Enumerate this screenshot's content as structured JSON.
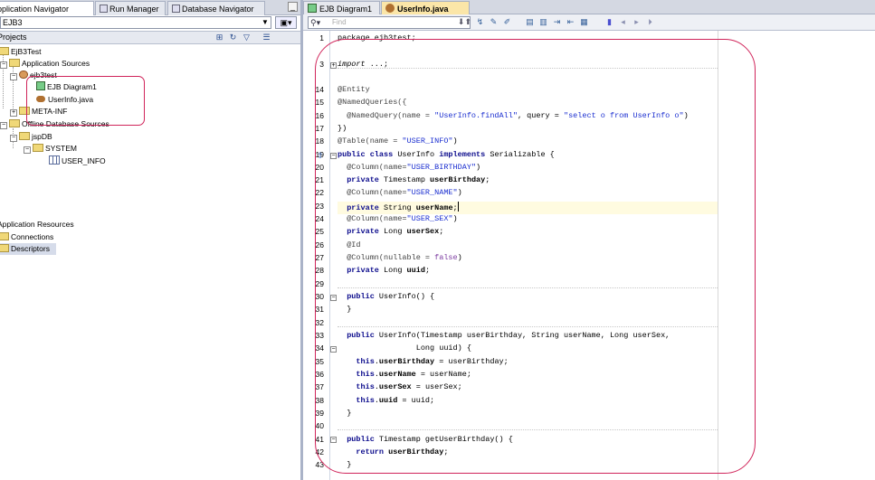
{
  "left_tabs": [
    "Application Navigator",
    "Run Manager",
    "Database Navigator"
  ],
  "app_combo_value": "EJB3",
  "projects_label": "Projects",
  "tree": {
    "project": "EjB3Test",
    "app_sources": "Application Sources",
    "package": "ejb3test",
    "diagram": "EJB Diagram1",
    "userinfo": "UserInfo.java",
    "metainf": "META-INF",
    "offline": "Offline Database Sources",
    "jspdb": "jspDB",
    "system": "SYSTEM",
    "user_info": "USER_INFO"
  },
  "resources": {
    "header": "Application Resources",
    "connections": "Connections",
    "descriptors": "Descriptors"
  },
  "editor_tabs": [
    "EJB Diagram1",
    "UserInfo.java"
  ],
  "find_placeholder": "Find",
  "line_numbers": [
    "1",
    "",
    "3",
    "",
    "",
    "14",
    "15",
    "16",
    "17",
    "18",
    "19",
    "20",
    "21",
    "22",
    "23",
    "24",
    "25",
    "26",
    "27",
    "28",
    "29",
    "30",
    "31",
    "32",
    "33",
    "34",
    "35",
    "36",
    "37",
    "38",
    "39",
    "40",
    "41",
    "42",
    "43"
  ],
  "code": {
    "l1": "package ejb3test;",
    "l3_kw": "import",
    "l3_rest": " ...;",
    "l14": "@Entity",
    "l15": "@NamedQueries({",
    "l16_a": "  @NamedQuery(name = ",
    "l16_s1": "\"UserInfo.findAll\"",
    "l16_b": ", query = ",
    "l16_s2": "\"select o from UserInfo o\"",
    "l16_c": ")",
    "l17": "})",
    "l18_a": "@Table(name = ",
    "l18_s": "\"USER_INFO\"",
    "l18_b": ")",
    "l19_k1": "public class",
    "l19_a": " UserInfo ",
    "l19_k2": "implements",
    "l19_b": " Serializable {",
    "l20_a": "  @Column(name=",
    "l20_s": "\"USER_BIRTHDAY\"",
    "l20_b": ")",
    "l21_k": "  private",
    "l21_a": " Timestamp ",
    "l21_b": "userBirthday",
    "l21_c": ";",
    "l22_a": "  @Column(name=",
    "l22_s": "\"USER_NAME\"",
    "l22_b": ")",
    "l23_k": "  private",
    "l23_a": " String ",
    "l23_b": "userName",
    "l23_c": ";",
    "l24_a": "  @Column(name=",
    "l24_s": "\"USER_SEX\"",
    "l24_b": ")",
    "l25_k": "  private",
    "l25_a": " Long ",
    "l25_b": "userSex",
    "l25_c": ";",
    "l26": "  @Id",
    "l27_a": "  @Column(nullable = ",
    "l27_k": "false",
    "l27_b": ")",
    "l28_k": "  private",
    "l28_a": " Long ",
    "l28_b": "uuid",
    "l28_c": ";",
    "l30_k": "  public",
    "l30_a": " UserInfo() {",
    "l31": "  }",
    "l33_k": "  public",
    "l33_a": " UserInfo(Timestamp userBirthday, String userName, Long userSex,",
    "l34": "                 Long uuid) {",
    "l35_k": "    this",
    "l35_a": ".",
    "l35_b": "userBirthday",
    "l35_c": " = userBirthday;",
    "l36_k": "    this",
    "l36_a": ".",
    "l36_b": "userName",
    "l36_c": " = userName;",
    "l37_k": "    this",
    "l37_a": ".",
    "l37_b": "userSex",
    "l37_c": " = userSex;",
    "l38_k": "    this",
    "l38_a": ".",
    "l38_b": "uuid",
    "l38_c": " = uuid;",
    "l39": "  }",
    "l41_k": "  public",
    "l41_a": " Timestamp getUserBirthday() {",
    "l42_k": "    return",
    "l42_b": " userBirthday",
    "l42_c": ";",
    "l43": "  }"
  }
}
